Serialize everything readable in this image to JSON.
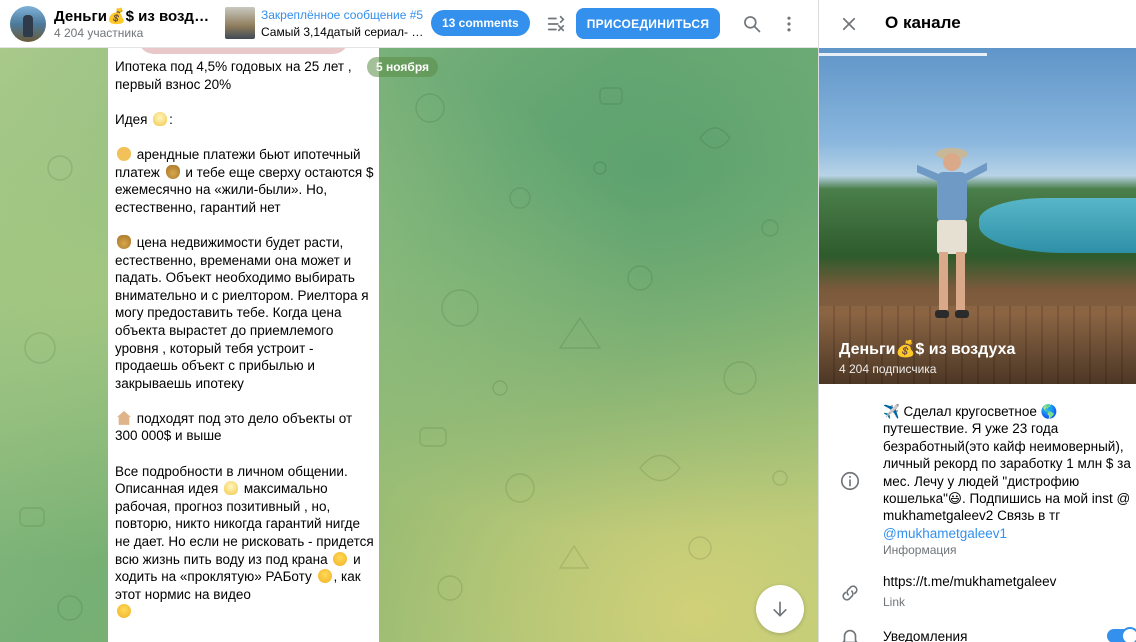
{
  "header": {
    "channel_title": "Деньги💰$ из возду…",
    "channel_subtitle": "4 204 участника",
    "pinned_title": "Закреплённое сообщение #5",
    "pinned_text": "Самый 3,14датый сериал- эт…",
    "comments_label": "13 comments",
    "join_label": "ПРИСОЕДИНИТЬСЯ"
  },
  "chat": {
    "date_label": "5 ноября",
    "message": {
      "p1": "Ипотека под 4,5% годовых на 25 лет , первый взнос 20%",
      "p2": "Идея",
      "p3": "арендные платежи бьют ипотечный платеж",
      "p3b": "и тебе еще сверху остаются $ ежемесячно на «жили-были». Но, естественно, гарантий нет",
      "p4": "цена недвижимости будет расти, естественно, временами она может и падать. Объект необходимо выбирать внимательно и с риелтором. Риелтора я могу предоставить тебе. Когда цена объекта вырастет до приемлемого уровня , который тебя устроит - продаешь объект с прибылью и закрываешь ипотеку",
      "p5": "подходят под это дело объекты от 300 000$ и выше",
      "p6a": "Все подробности в личном общении. Описанная идея",
      "p6b": "максимально рабочая, прогноз позитивный , но, повторю, никто никогда гарантий нигде не дает. Но если не рисковать - придется всю жизнь пить воду из под крана",
      "p6c": "и ходить на «проклятую» РАБоту",
      "p6d": ", как этот нормис на видео"
    }
  },
  "panel": {
    "title": "О канале",
    "channel_name": "Деньги💰$ из воздуха",
    "subscribers": "4 204 подписчика",
    "info_text_1": "✈️ Сделал кругосветное 🌎 путешествие. Я уже 23 года безработный(это кайф неимоверный), личный рекорд по заработку 1 млн $ за мес. Лечу у людей \"дистрофию кошелька\"😃. Подпишись на мой inst @ mukhametgaleev2 Связь в тг",
    "info_link": "@mukhametgaleev1",
    "info_label": "Информация",
    "link_text": "https://t.me/mukhametgaleev",
    "link_label": "Link",
    "notifications_label": "Уведомления"
  },
  "colors": {
    "accent": "#3390ec",
    "muted": "#707579"
  }
}
